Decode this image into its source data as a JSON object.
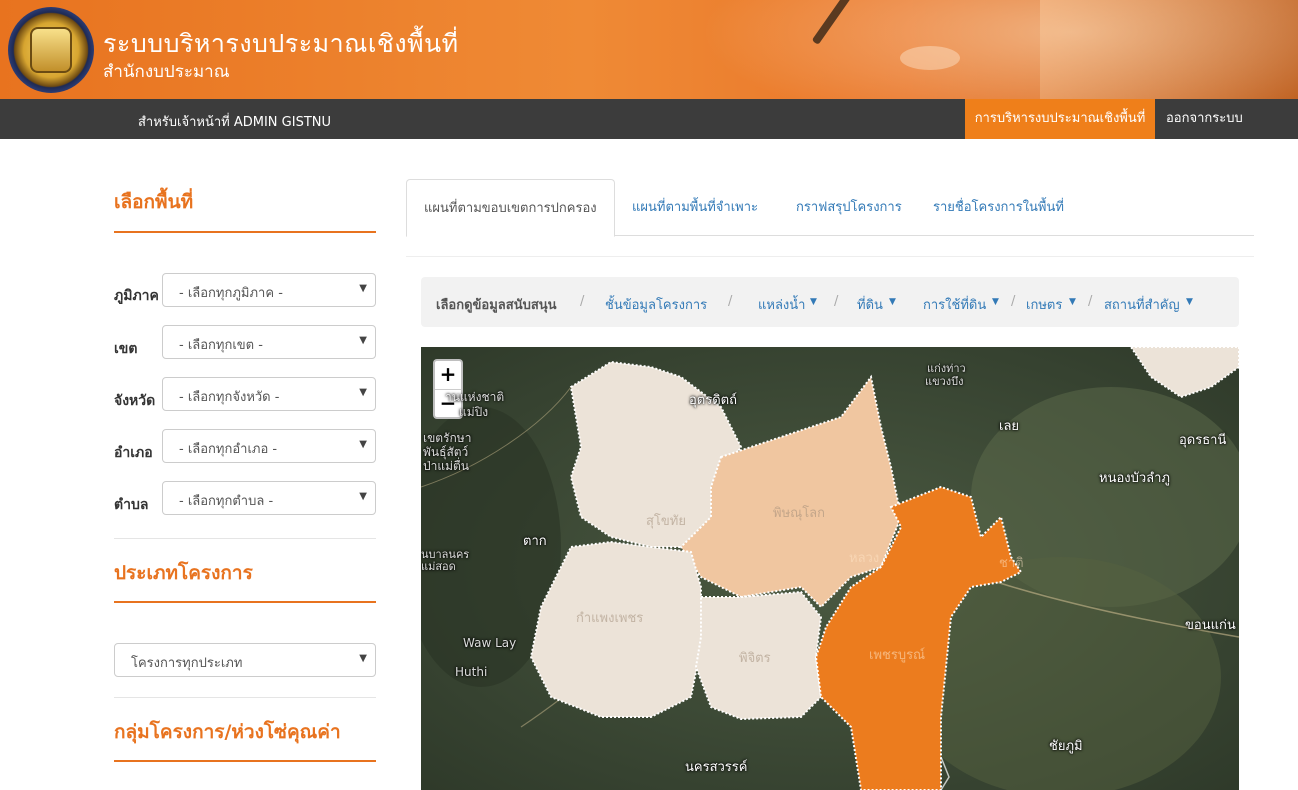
{
  "header": {
    "title": "ระบบบริหารงบประมาณเชิงพื้นที่",
    "subtitle": "สำนักงบประมาณ",
    "logo_icon": "government-seal"
  },
  "navbar": {
    "user_text": "สำหรับเจ้าหน้าที่ ADMIN GISTNU",
    "active_item": "การบริหารงบประมาณเชิงพื้นที่",
    "logout": "ออกจากระบบ",
    "accent_color": "#ef7f1a"
  },
  "sidebar": {
    "area_heading": "เลือกพื้นที่",
    "filters": [
      {
        "label": "ภูมิภาค",
        "value": "- เลือกทุกภูมิภาค -"
      },
      {
        "label": "เขต",
        "value": "- เลือกทุกเขต -"
      },
      {
        "label": "จังหวัด",
        "value": "- เลือกทุกจังหวัด -"
      },
      {
        "label": "อำเภอ",
        "value": "- เลือกทุกอำเภอ -"
      },
      {
        "label": "ตำบล",
        "value": "- เลือกทุกตำบล -"
      }
    ],
    "project_type_heading": "ประเภทโครงการ",
    "project_type_value": "โครงการทุกประเภท",
    "group_heading": "กลุ่มโครงการ/ห่วงโซ่คุณค่า"
  },
  "tabs": [
    {
      "label": "แผนที่ตามขอบเขตการปกครอง",
      "active": true
    },
    {
      "label": "แผนที่ตามพื้นที่จำเพาะ",
      "active": false
    },
    {
      "label": "กราฟสรุปโครงการ",
      "active": false
    },
    {
      "label": "รายชื่อโครงการในพื้นที่",
      "active": false
    }
  ],
  "data_bar": {
    "label": "เลือกดูข้อมูลสนับสนุน",
    "items": [
      "ชั้นข้อมูลโครงการ",
      "แหล่งน้ำ",
      "ที่ดิน",
      "การใช้ที่ดิน",
      "เกษตร",
      "สถานที่สำคัญ"
    ]
  },
  "map": {
    "zoom_in": "+",
    "zoom_out": "−",
    "labels": {
      "uttaradit": "อุตรดิตถ์",
      "loei": "เลย",
      "udon": "อุดรธานี",
      "nongbua": "หนองบัวลำภู",
      "tak": "ตาก",
      "khonkaen": "ขอนแก่น",
      "chaiyaphum": "ชัยภูมิ",
      "nakhonsawan": "นครสวรรค์",
      "phitsanulok": "พิษณุโลก",
      "sukhothai": "สุโขทัย",
      "kamphaengphet": "กำแพงเพชร",
      "phichit": "พิจิตร",
      "phetchabun": "เพชรบูรณ์",
      "wawlay": "Waw Lay",
      "huthi": "Huthi",
      "np1": "านแห่งชาติ",
      "np1b": "แม่ปิง",
      "np2": "เขตรักษา",
      "np2b": "พันธุ์สัตว์",
      "np2c": "ป่าแม่ตื่น",
      "np3": "นบาลนคร",
      "np3b": "แม่สอด",
      "np4": "แก่งท่าว",
      "np4b": "แขวงบึง",
      "np5": "หลวง",
      "np6": "ชาติ"
    },
    "colors": {
      "selected": "#ec7c1e",
      "medium": "#f0c6a0",
      "light": "#ece3d8"
    }
  }
}
